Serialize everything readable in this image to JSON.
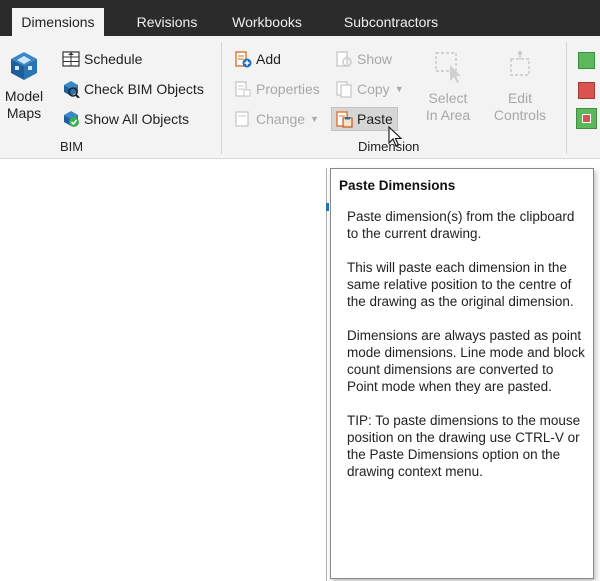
{
  "tabs": [
    {
      "label": "Dimensions",
      "active": true
    },
    {
      "label": "Revisions",
      "active": false
    },
    {
      "label": "Workbooks",
      "active": false
    },
    {
      "label": "Subcontractors",
      "active": false
    }
  ],
  "bim_group": {
    "label": "BIM",
    "model_maps": {
      "line1": "Model",
      "line2": "Maps",
      "icon": "model-maps-icon"
    },
    "schedule": {
      "label": "Schedule",
      "icon": "schedule-icon"
    },
    "check_bim": {
      "label": "Check BIM Objects",
      "icon": "check-bim-icon"
    },
    "show_all": {
      "label": "Show All Objects",
      "icon": "show-all-icon"
    }
  },
  "dimension_group": {
    "label": "Dimension",
    "add": {
      "label": "Add",
      "icon": "add-icon"
    },
    "properties": {
      "label": "Properties",
      "icon": "properties-icon",
      "disabled": true
    },
    "change": {
      "label": "Change",
      "icon": "change-icon",
      "disabled": true
    },
    "show": {
      "label": "Show",
      "icon": "show-icon",
      "disabled": true
    },
    "copy": {
      "label": "Copy",
      "icon": "copy-icon",
      "disabled": true
    },
    "paste": {
      "label": "Paste",
      "icon": "paste-icon",
      "active": true
    },
    "select_in_area": {
      "line1": "Select",
      "line2": "In Area",
      "icon": "select-area-icon",
      "disabled": true
    },
    "edit_controls": {
      "line1": "Edit",
      "line2": "Controls",
      "icon": "edit-controls-icon",
      "disabled": true
    }
  },
  "colors": {
    "tab_bar": "#2b2b2b",
    "ribbon": "#f3f3f3",
    "green_swatch": "#5cb85c",
    "red_swatch": "#d9534f",
    "paste_highlight": "#d6d6d6"
  },
  "tooltip": {
    "title": "Paste Dimensions",
    "paragraphs": [
      "Paste dimension(s) from the clipboard to the current drawing.",
      "This will paste each dimension in the same relative position to the centre of the drawing as the original dimension.",
      "Dimensions are always pasted as point mode dimensions. Line mode and block count dimensions are converted to Point mode when they are pasted.",
      "TIP: To paste dimensions to the mouse position on the drawing use CTRL-V or the Paste Dimensions option on the drawing context menu."
    ]
  }
}
